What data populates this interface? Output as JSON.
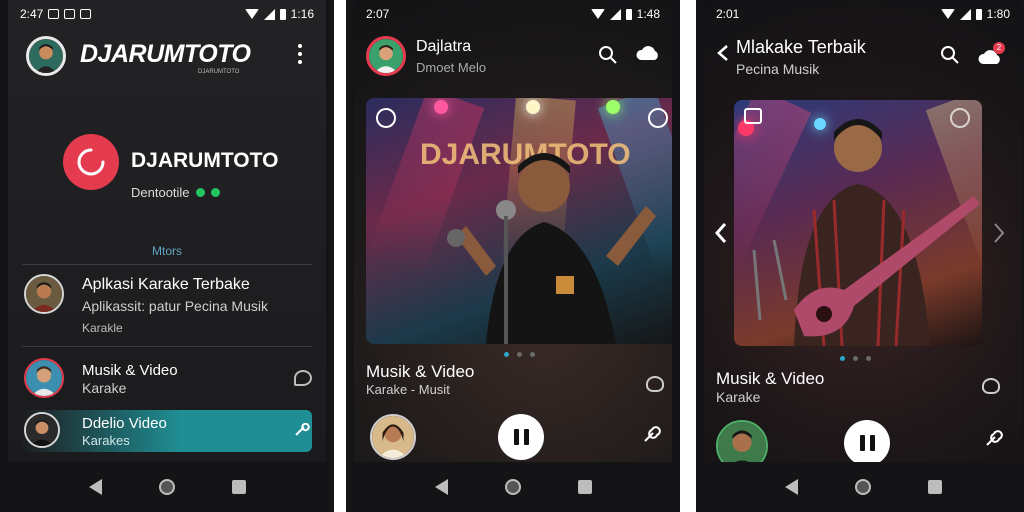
{
  "status": {
    "p1": {
      "time": "2:47",
      "battery": "1:16"
    },
    "p2": {
      "time": "2:07",
      "battery": "1:48"
    },
    "p3": {
      "time": "2:01",
      "battery": "1:80"
    }
  },
  "screen1": {
    "app_title": "DJARUMTOTO",
    "app_subtitle": "DJARUMTOTO",
    "profile_name": "DJARUMTOTO",
    "profile_status": "Dentootile",
    "section_label": "Mtors",
    "items": [
      {
        "title": "Aplkasi Karake Terbake",
        "subtitle": "Aplikassit: patur Pecina Musik",
        "meta": "Karakle"
      },
      {
        "title": "Musik & Video",
        "subtitle": "Karake"
      },
      {
        "title": "Ddelio Video",
        "subtitle": "Karakes"
      }
    ]
  },
  "screen2": {
    "header_title": "Dajlatra",
    "header_subtitle": "Dmoet Melo",
    "banner_text": "DJARUMTOTO",
    "track_title": "Musik & Video",
    "track_subtitle": "Karake - Musit"
  },
  "screen3": {
    "header_title": "Mlakake Terbaik",
    "header_subtitle": "Pecina Musik",
    "badge": "2",
    "track_title": "Musik & Video",
    "track_subtitle": "Karake"
  },
  "colors": {
    "accent_red": "#e43b4e",
    "accent_teal": "#1f8f95",
    "dot_active": "#2aa6c7",
    "online_green": "#22c55e"
  }
}
